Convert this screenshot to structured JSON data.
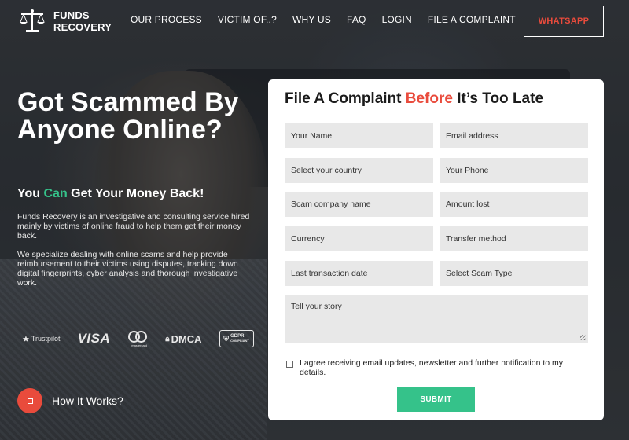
{
  "brand": {
    "line1": "FUNDS",
    "line2": "RECOVERY"
  },
  "nav": {
    "items": [
      {
        "label": "OUR PROCESS"
      },
      {
        "label": "VICTIM OF..?"
      },
      {
        "label": "WHY US"
      },
      {
        "label": "FAQ"
      },
      {
        "label": "LOGIN"
      },
      {
        "label": "FILE A COMPLAINT"
      }
    ],
    "whatsapp_label": "WHATSAPP"
  },
  "hero": {
    "title": "Got Scammed By Anyone Online?",
    "subtitle_pre": "You ",
    "subtitle_highlight": "Can",
    "subtitle_post": " Get Your Money Back!",
    "paragraph1": "Funds Recovery is an investigative and consulting service hired mainly by victims of online fraud to help them get their money back.",
    "paragraph2": "We specialize dealing with online scams and help provide reimbursement to their victims using disputes, tracking down digital fingerprints, cyber analysis and thorough investigative work."
  },
  "badges": {
    "trustpilot": "Trustpilot",
    "visa": "VISA",
    "mastercard": "mastercard",
    "dmca": "DMCA",
    "gdpr_line1": "GDPR",
    "gdpr_line2": "COMPLIANT"
  },
  "how_it_works": {
    "label": "How It Works?"
  },
  "form": {
    "title_pre": "File A Complaint ",
    "title_highlight": "Before",
    "title_post": " It’s Too Late",
    "fields": {
      "name": "Your Name",
      "email": "Email address",
      "country": "Select your country",
      "phone": "Your Phone",
      "company": "Scam company name",
      "amount": "Amount lost",
      "currency": "Currency",
      "transfer": "Transfer method",
      "date": "Last transaction date",
      "scam_type": "Select Scam Type",
      "story": "Tell your story"
    },
    "consent": "I agree receiving email updates, newsletter and further notification to my details.",
    "submit_label": "SUBMIT"
  },
  "colors": {
    "accent_red": "#e94b3c",
    "accent_green": "#35c28a"
  }
}
